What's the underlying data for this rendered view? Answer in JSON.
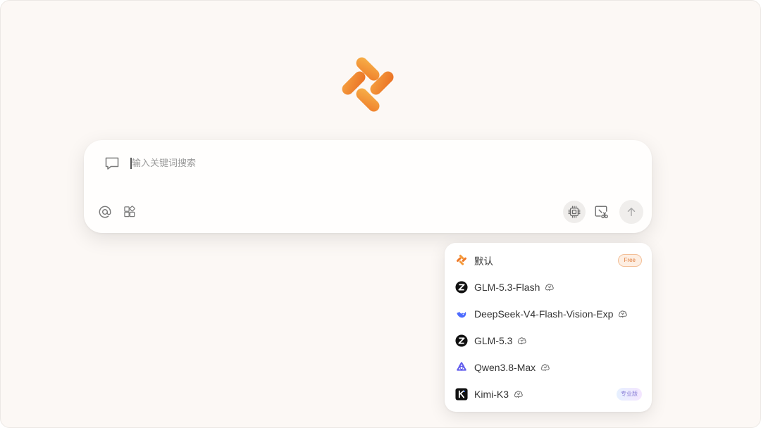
{
  "search": {
    "placeholder": "输入关键词搜索",
    "value": ""
  },
  "toolbar": {
    "left_icons": [
      "at-icon",
      "apps-icon"
    ],
    "right_icons": [
      "chip-icon",
      "screenshot-icon",
      "arrow-up-icon"
    ]
  },
  "models": [
    {
      "name": "默认",
      "logo": "app-logo-icon",
      "badge": "Free",
      "thinking": false
    },
    {
      "name": "GLM-5.3-Flash",
      "logo": "zhipu-logo-icon",
      "badge": "",
      "thinking": true
    },
    {
      "name": "DeepSeek-V4-Flash-Vision-Exp",
      "logo": "deepseek-logo-icon",
      "badge": "",
      "thinking": true
    },
    {
      "name": "GLM-5.3",
      "logo": "zhipu-logo-icon",
      "badge": "",
      "thinking": true
    },
    {
      "name": "Qwen3.8-Max",
      "logo": "qwen-logo-icon",
      "badge": "",
      "thinking": true
    },
    {
      "name": "Kimi-K3",
      "logo": "kimi-logo-icon",
      "badge": "专业版",
      "thinking": true
    }
  ],
  "colors": {
    "accent": "#f08a2c",
    "background": "#fcf8f5",
    "text": "#333333",
    "placeholder": "#9a9a9a"
  }
}
